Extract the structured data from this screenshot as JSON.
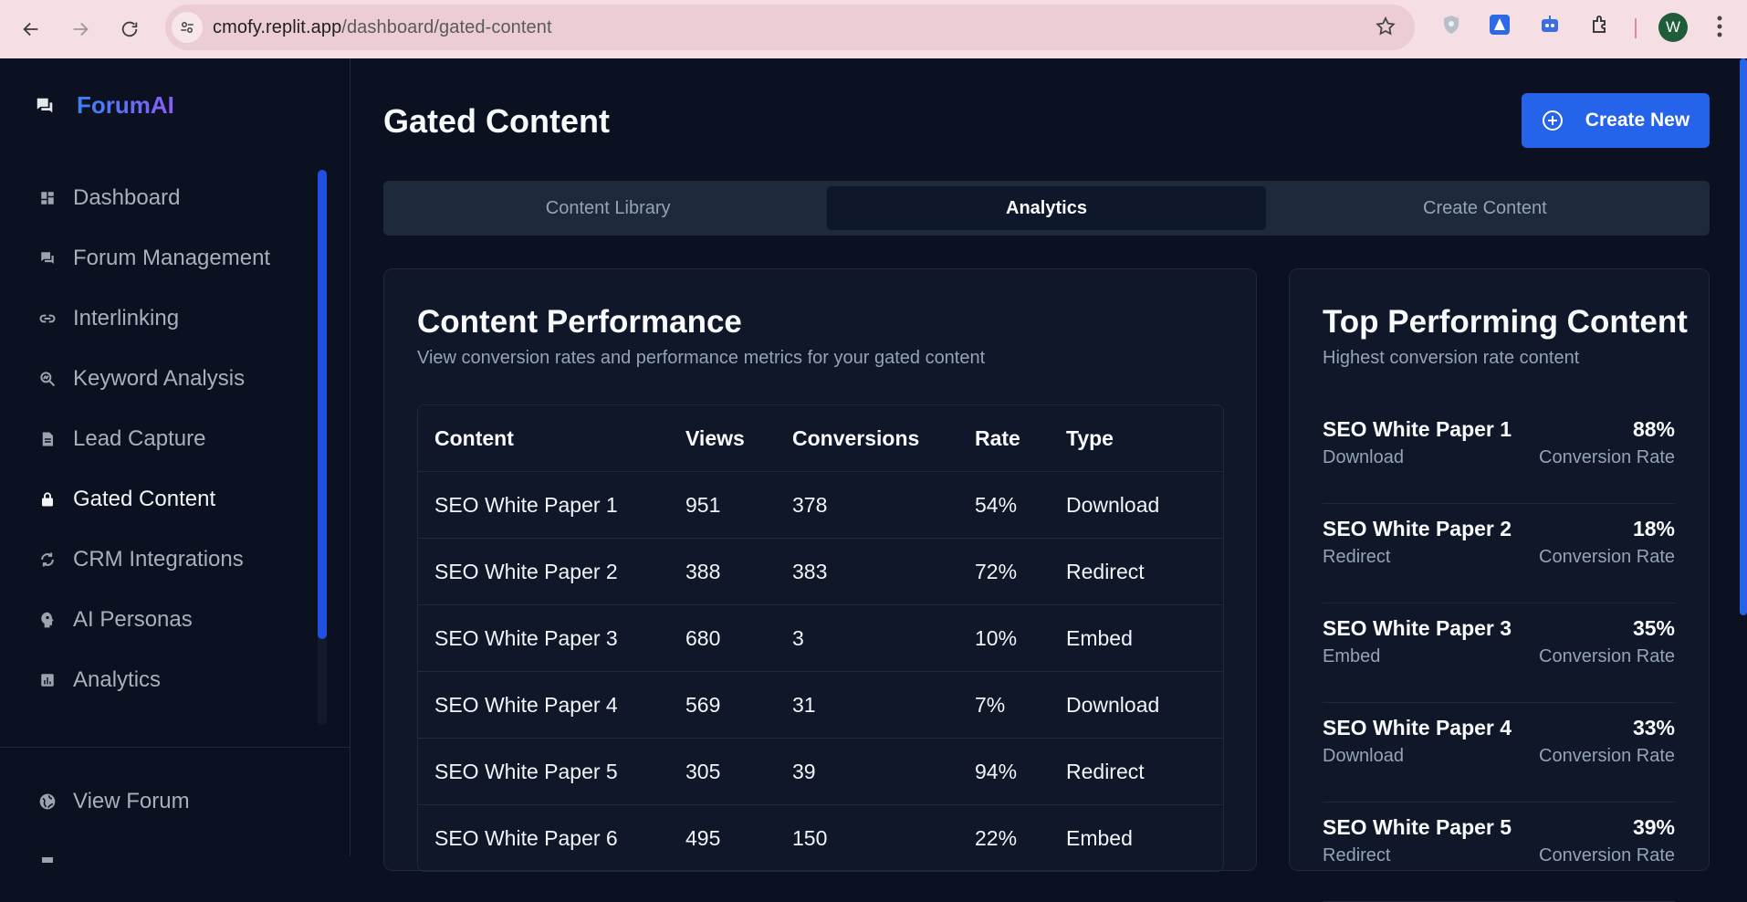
{
  "browser": {
    "url_host": "cmofy.replit.app",
    "url_path": "/dashboard/gated-content",
    "profile_initial": "W"
  },
  "sidebar": {
    "brand": "ForumAI",
    "items": [
      {
        "label": "Dashboard",
        "icon": "dashboard-icon"
      },
      {
        "label": "Forum Management",
        "icon": "forum-icon"
      },
      {
        "label": "Interlinking",
        "icon": "link-icon"
      },
      {
        "label": "Keyword Analysis",
        "icon": "search-chart-icon"
      },
      {
        "label": "Lead Capture",
        "icon": "document-icon"
      },
      {
        "label": "Gated Content",
        "icon": "lock-icon",
        "active": true
      },
      {
        "label": "CRM Integrations",
        "icon": "sync-icon"
      },
      {
        "label": "AI Personas",
        "icon": "persona-icon"
      },
      {
        "label": "Analytics",
        "icon": "analytics-icon"
      }
    ],
    "footer_item": {
      "label": "View Forum",
      "icon": "globe-icon"
    }
  },
  "header": {
    "title": "Gated Content",
    "create_button": "Create New"
  },
  "tabs": [
    {
      "label": "Content Library"
    },
    {
      "label": "Analytics",
      "active": true
    },
    {
      "label": "Create Content"
    }
  ],
  "performance": {
    "title": "Content Performance",
    "subtitle": "View conversion rates and performance metrics for your gated content",
    "columns": [
      "Content",
      "Views",
      "Conversions",
      "Rate",
      "Type"
    ],
    "rows": [
      [
        "SEO White Paper 1",
        "951",
        "378",
        "54%",
        "Download"
      ],
      [
        "SEO White Paper 2",
        "388",
        "383",
        "72%",
        "Redirect"
      ],
      [
        "SEO White Paper 3",
        "680",
        "3",
        "10%",
        "Embed"
      ],
      [
        "SEO White Paper 4",
        "569",
        "31",
        "7%",
        "Download"
      ],
      [
        "SEO White Paper 5",
        "305",
        "39",
        "94%",
        "Redirect"
      ],
      [
        "SEO White Paper 6",
        "495",
        "150",
        "22%",
        "Embed"
      ]
    ]
  },
  "top_content": {
    "title": "Top Performing Content",
    "subtitle": "Highest conversion rate content",
    "rate_label": "Conversion Rate",
    "items": [
      {
        "name": "SEO White Paper 1",
        "type": "Download",
        "rate": "88%"
      },
      {
        "name": "SEO White Paper 2",
        "type": "Redirect",
        "rate": "18%"
      },
      {
        "name": "SEO White Paper 3",
        "type": "Embed",
        "rate": "35%"
      },
      {
        "name": "SEO White Paper 4",
        "type": "Download",
        "rate": "33%"
      },
      {
        "name": "SEO White Paper 5",
        "type": "Redirect",
        "rate": "39%"
      }
    ]
  },
  "colors": {
    "accent": "#2563eb",
    "background": "#0b1120",
    "card": "#0f1729"
  }
}
